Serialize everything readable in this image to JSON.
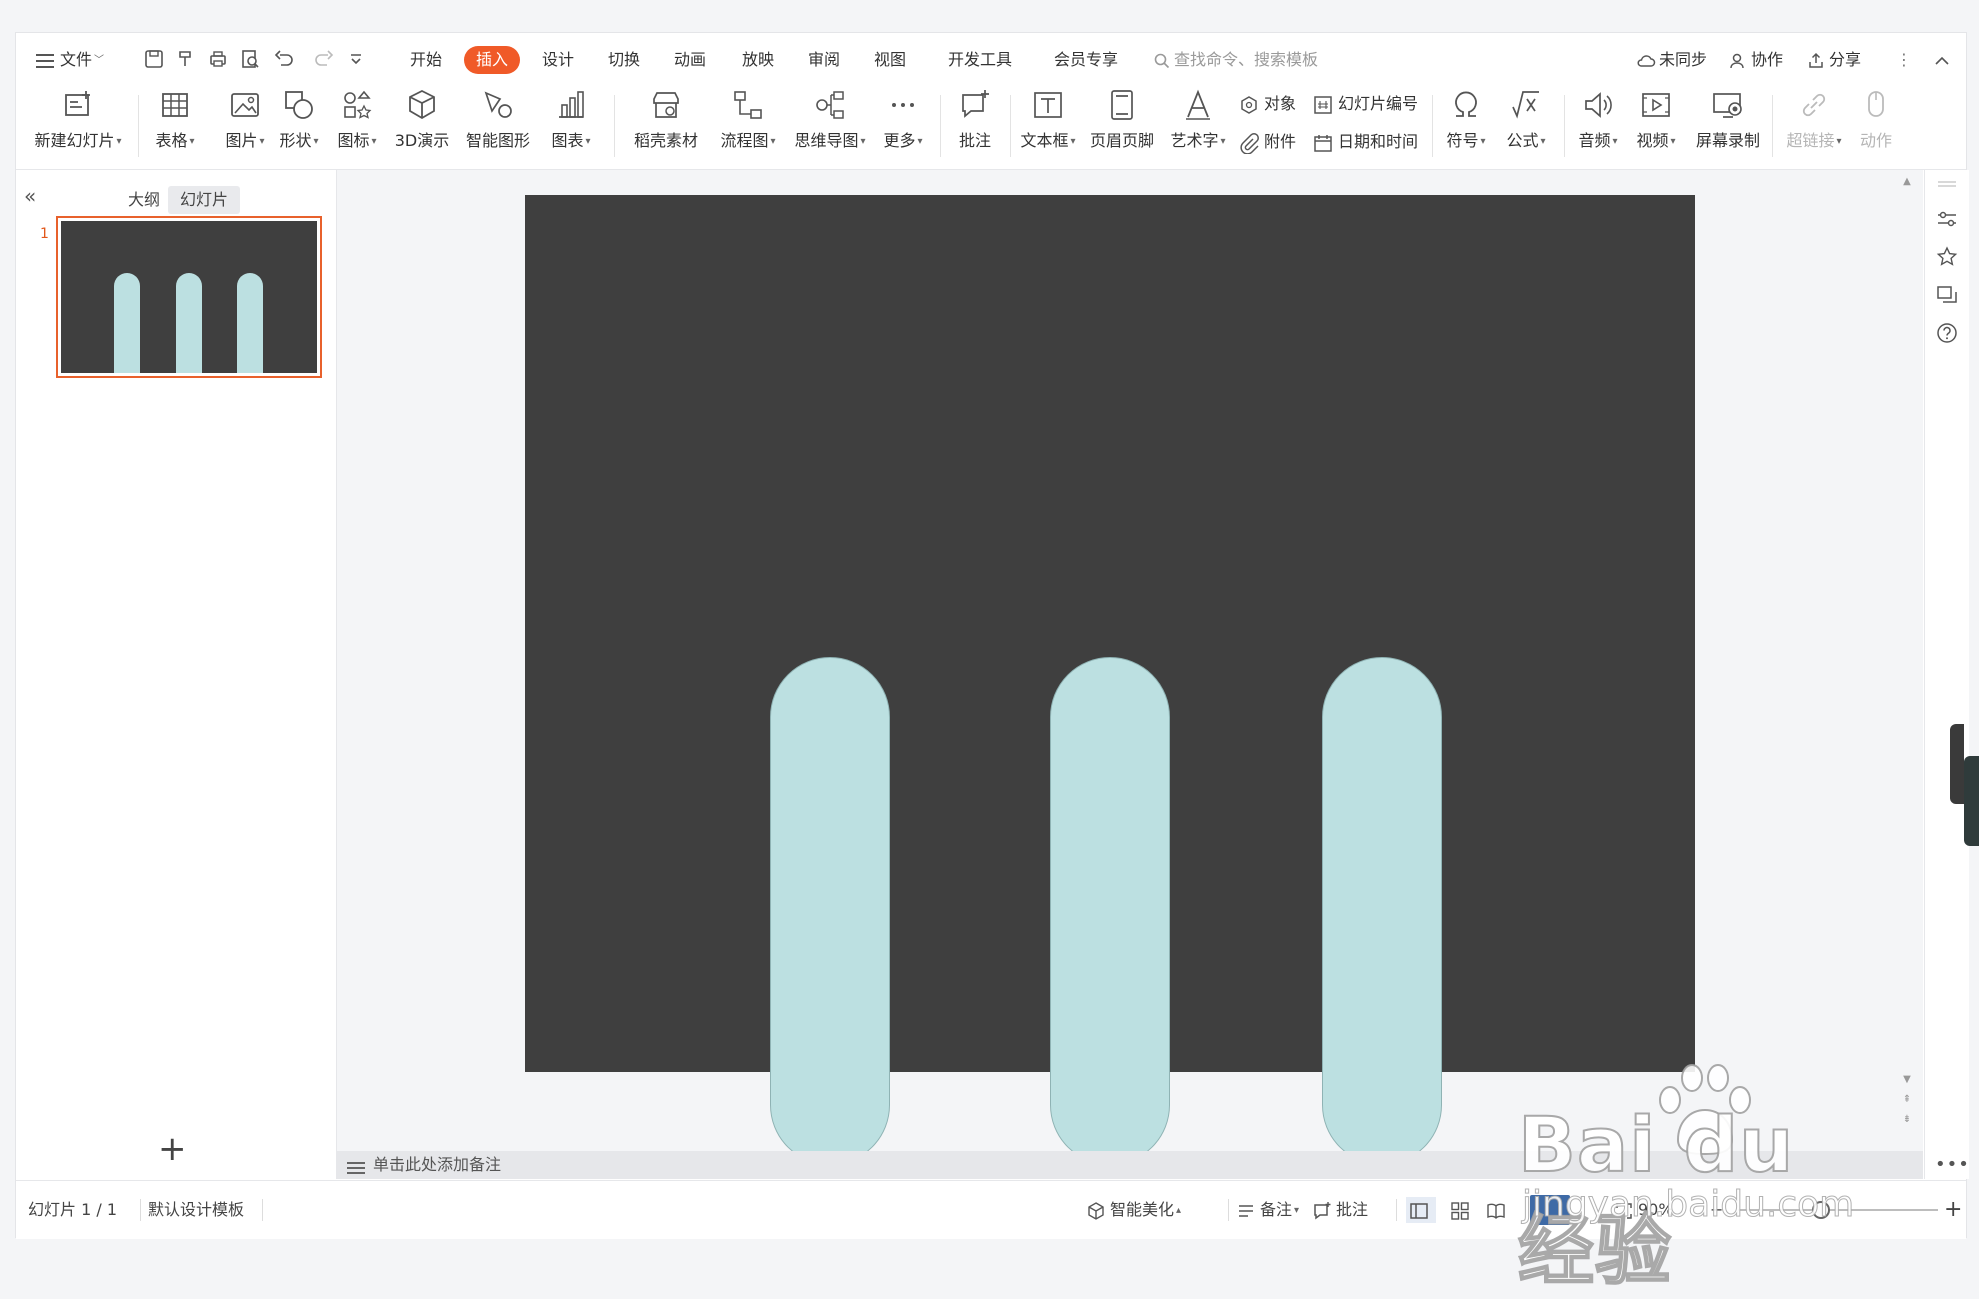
{
  "menubar": {
    "file": "文件",
    "tabs": [
      "开始",
      "插入",
      "设计",
      "切换",
      "动画",
      "放映",
      "审阅",
      "视图",
      "开发工具",
      "会员专享"
    ],
    "active_tab": "插入",
    "search_placeholder": "查找命令、搜索模板",
    "sync": "未同步",
    "collab": "协作",
    "share": "分享"
  },
  "ribbon": {
    "new_slide": "新建幻灯片",
    "table": "表格",
    "picture": "图片",
    "shape": "形状",
    "icon": "图标",
    "demo3d": "3D演示",
    "smartart": "智能图形",
    "chart": "图表",
    "material": "稻壳素材",
    "flowchart": "流程图",
    "mindmap": "思维导图",
    "more": "更多",
    "comment": "批注",
    "textbox": "文本框",
    "header_footer": "页眉页脚",
    "wordart": "艺术字",
    "object": "对象",
    "slide_number": "幻灯片编号",
    "attachment": "附件",
    "date_time": "日期和时间",
    "symbol": "符号",
    "formula": "公式",
    "audio": "音频",
    "video": "视频",
    "screen_record": "屏幕录制",
    "hyperlink": "超链接",
    "action": "动作"
  },
  "leftpanel": {
    "collapse": "«",
    "outline_tab": "大纲",
    "slides_tab": "幻灯片",
    "slide_number": "1",
    "add": "+"
  },
  "notes": {
    "placeholder": "单击此处添加备注"
  },
  "status": {
    "slide_info": "幻灯片 1 / 1",
    "template": "默认设计模板",
    "beautify": "智能美化",
    "notes": "备注",
    "comment": "批注",
    "zoom": "90%",
    "plus": "+"
  },
  "watermark": {
    "brand": "Bai  du 经验",
    "url": "jingyan.baidu.com"
  },
  "colors": {
    "accent": "#f05a28",
    "slide_bg": "#3f3f3f",
    "pill_fill": "#bce0e1",
    "pill_stroke": "#8fb3b4"
  }
}
